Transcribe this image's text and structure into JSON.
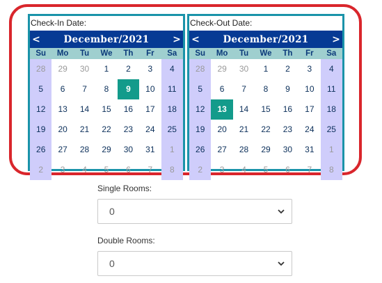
{
  "checkin": {
    "label": "Check-In Date:",
    "month_title": "December/2021",
    "prev": "<",
    "next": ">",
    "weekdays": [
      "Su",
      "Mo",
      "Tu",
      "We",
      "Th",
      "Fr",
      "Sa"
    ],
    "selected": "9",
    "weeks": [
      [
        "28",
        "29",
        "30",
        "1",
        "2",
        "3",
        "4"
      ],
      [
        "5",
        "6",
        "7",
        "8",
        "9",
        "10",
        "11"
      ],
      [
        "12",
        "13",
        "14",
        "15",
        "16",
        "17",
        "18"
      ],
      [
        "19",
        "20",
        "21",
        "22",
        "23",
        "24",
        "25"
      ],
      [
        "26",
        "27",
        "28",
        "29",
        "30",
        "31",
        "1"
      ],
      [
        "2",
        "3",
        "4",
        "5",
        "6",
        "7",
        "8"
      ]
    ]
  },
  "checkout": {
    "label": "Check-Out Date:",
    "month_title": "December/2021",
    "prev": "<",
    "next": ">",
    "weekdays": [
      "Su",
      "Mo",
      "Tu",
      "We",
      "Th",
      "Fr",
      "Sa"
    ],
    "selected": "13",
    "weeks": [
      [
        "28",
        "29",
        "30",
        "1",
        "2",
        "3",
        "4"
      ],
      [
        "5",
        "6",
        "7",
        "8",
        "9",
        "10",
        "11"
      ],
      [
        "12",
        "13",
        "14",
        "15",
        "16",
        "17",
        "18"
      ],
      [
        "19",
        "20",
        "21",
        "22",
        "23",
        "24",
        "25"
      ],
      [
        "26",
        "27",
        "28",
        "29",
        "30",
        "31",
        "1"
      ],
      [
        "2",
        "3",
        "4",
        "5",
        "6",
        "7",
        "8"
      ]
    ]
  },
  "single_rooms": {
    "label": "Single Rooms:",
    "value": "0"
  },
  "double_rooms": {
    "label": "Double Rooms:",
    "value": "0"
  },
  "colors": {
    "highlight": "#d9262c",
    "calendar_border": "#1a93a9",
    "header": "#063a94",
    "weekday_bar": "#9fcfcf",
    "weekend": "#cfcdfb",
    "selected": "#139b8b"
  }
}
